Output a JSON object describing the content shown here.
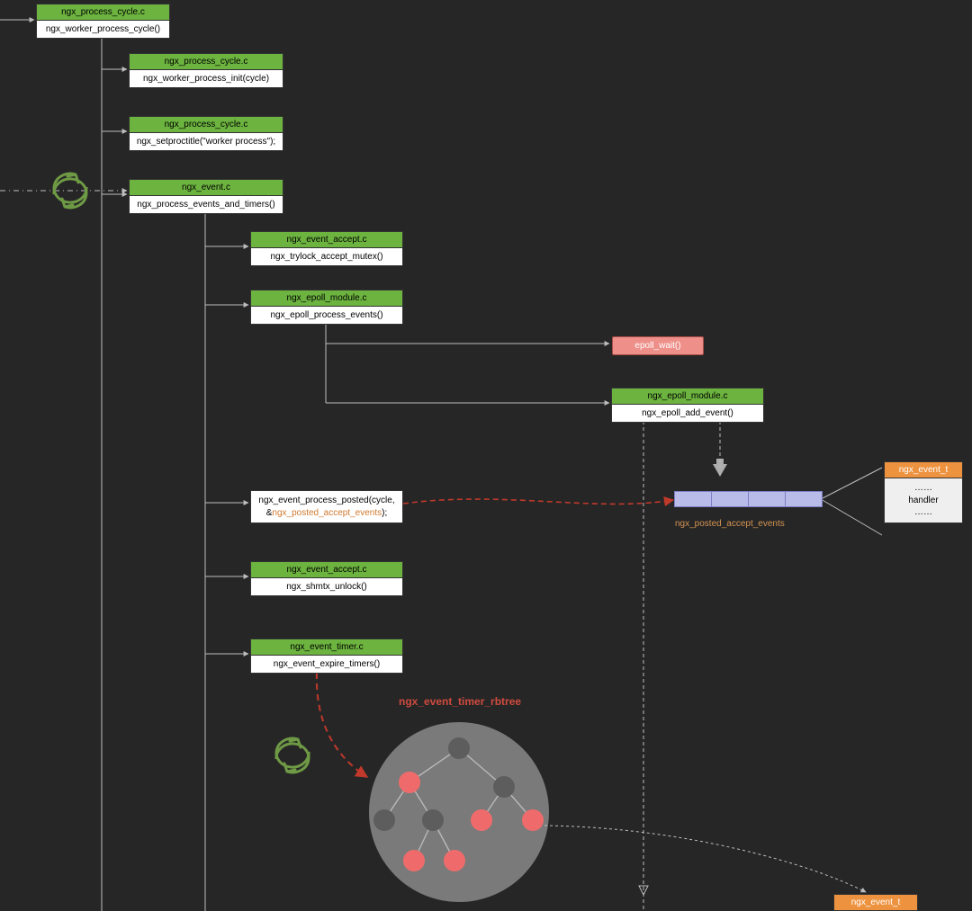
{
  "colors": {
    "bg": "#262626",
    "headerGreen": "#6cb33f",
    "headerOrange": "#ed923e",
    "pill": "#ee8f89",
    "queue": "#b9bbe9",
    "red": "#d04b3f",
    "orangeText": "#d49452",
    "cycle": "#6f9a45"
  },
  "boxes": {
    "b1": {
      "file": "ngx_process_cycle.c",
      "func": "ngx_worker_process_cycle()"
    },
    "b2": {
      "file": "ngx_process_cycle.c",
      "func": "ngx_worker_process_init(cycle)"
    },
    "b3": {
      "file": "ngx_process_cycle.c",
      "func": "ngx_setproctitle(\"worker process\");"
    },
    "b4": {
      "file": "ngx_event.c",
      "func": "ngx_process_events_and_timers()"
    },
    "b5": {
      "file": "ngx_event_accept.c",
      "func": "ngx_trylock_accept_mutex()"
    },
    "b6": {
      "file": "ngx_epoll_module.c",
      "func": "ngx_epoll_process_events()"
    },
    "b7": {
      "file": "ngx_epoll_module.c",
      "func": "ngx_epoll_add_event()"
    },
    "b8": {
      "line1": "ngx_event_process_posted(cycle,",
      "line2a": "&",
      "line2b": "ngx_posted_accept_events",
      "line2c": ");"
    },
    "b9": {
      "file": "ngx_event_accept.c",
      "func": "ngx_shmtx_unlock()"
    },
    "b10": {
      "file": "ngx_event_timer.c",
      "func": "ngx_event_expire_timers()"
    },
    "b11": {
      "file": "ngx_event_t",
      "r1": "……",
      "r2": "handler",
      "r3": "……"
    },
    "b12": {
      "file": "ngx_event_t"
    }
  },
  "pill": {
    "label": "epoll_wait()"
  },
  "queueLabel": "ngx_posted_accept_events",
  "rbtreeLabel": "ngx_event_timer_rbtree"
}
